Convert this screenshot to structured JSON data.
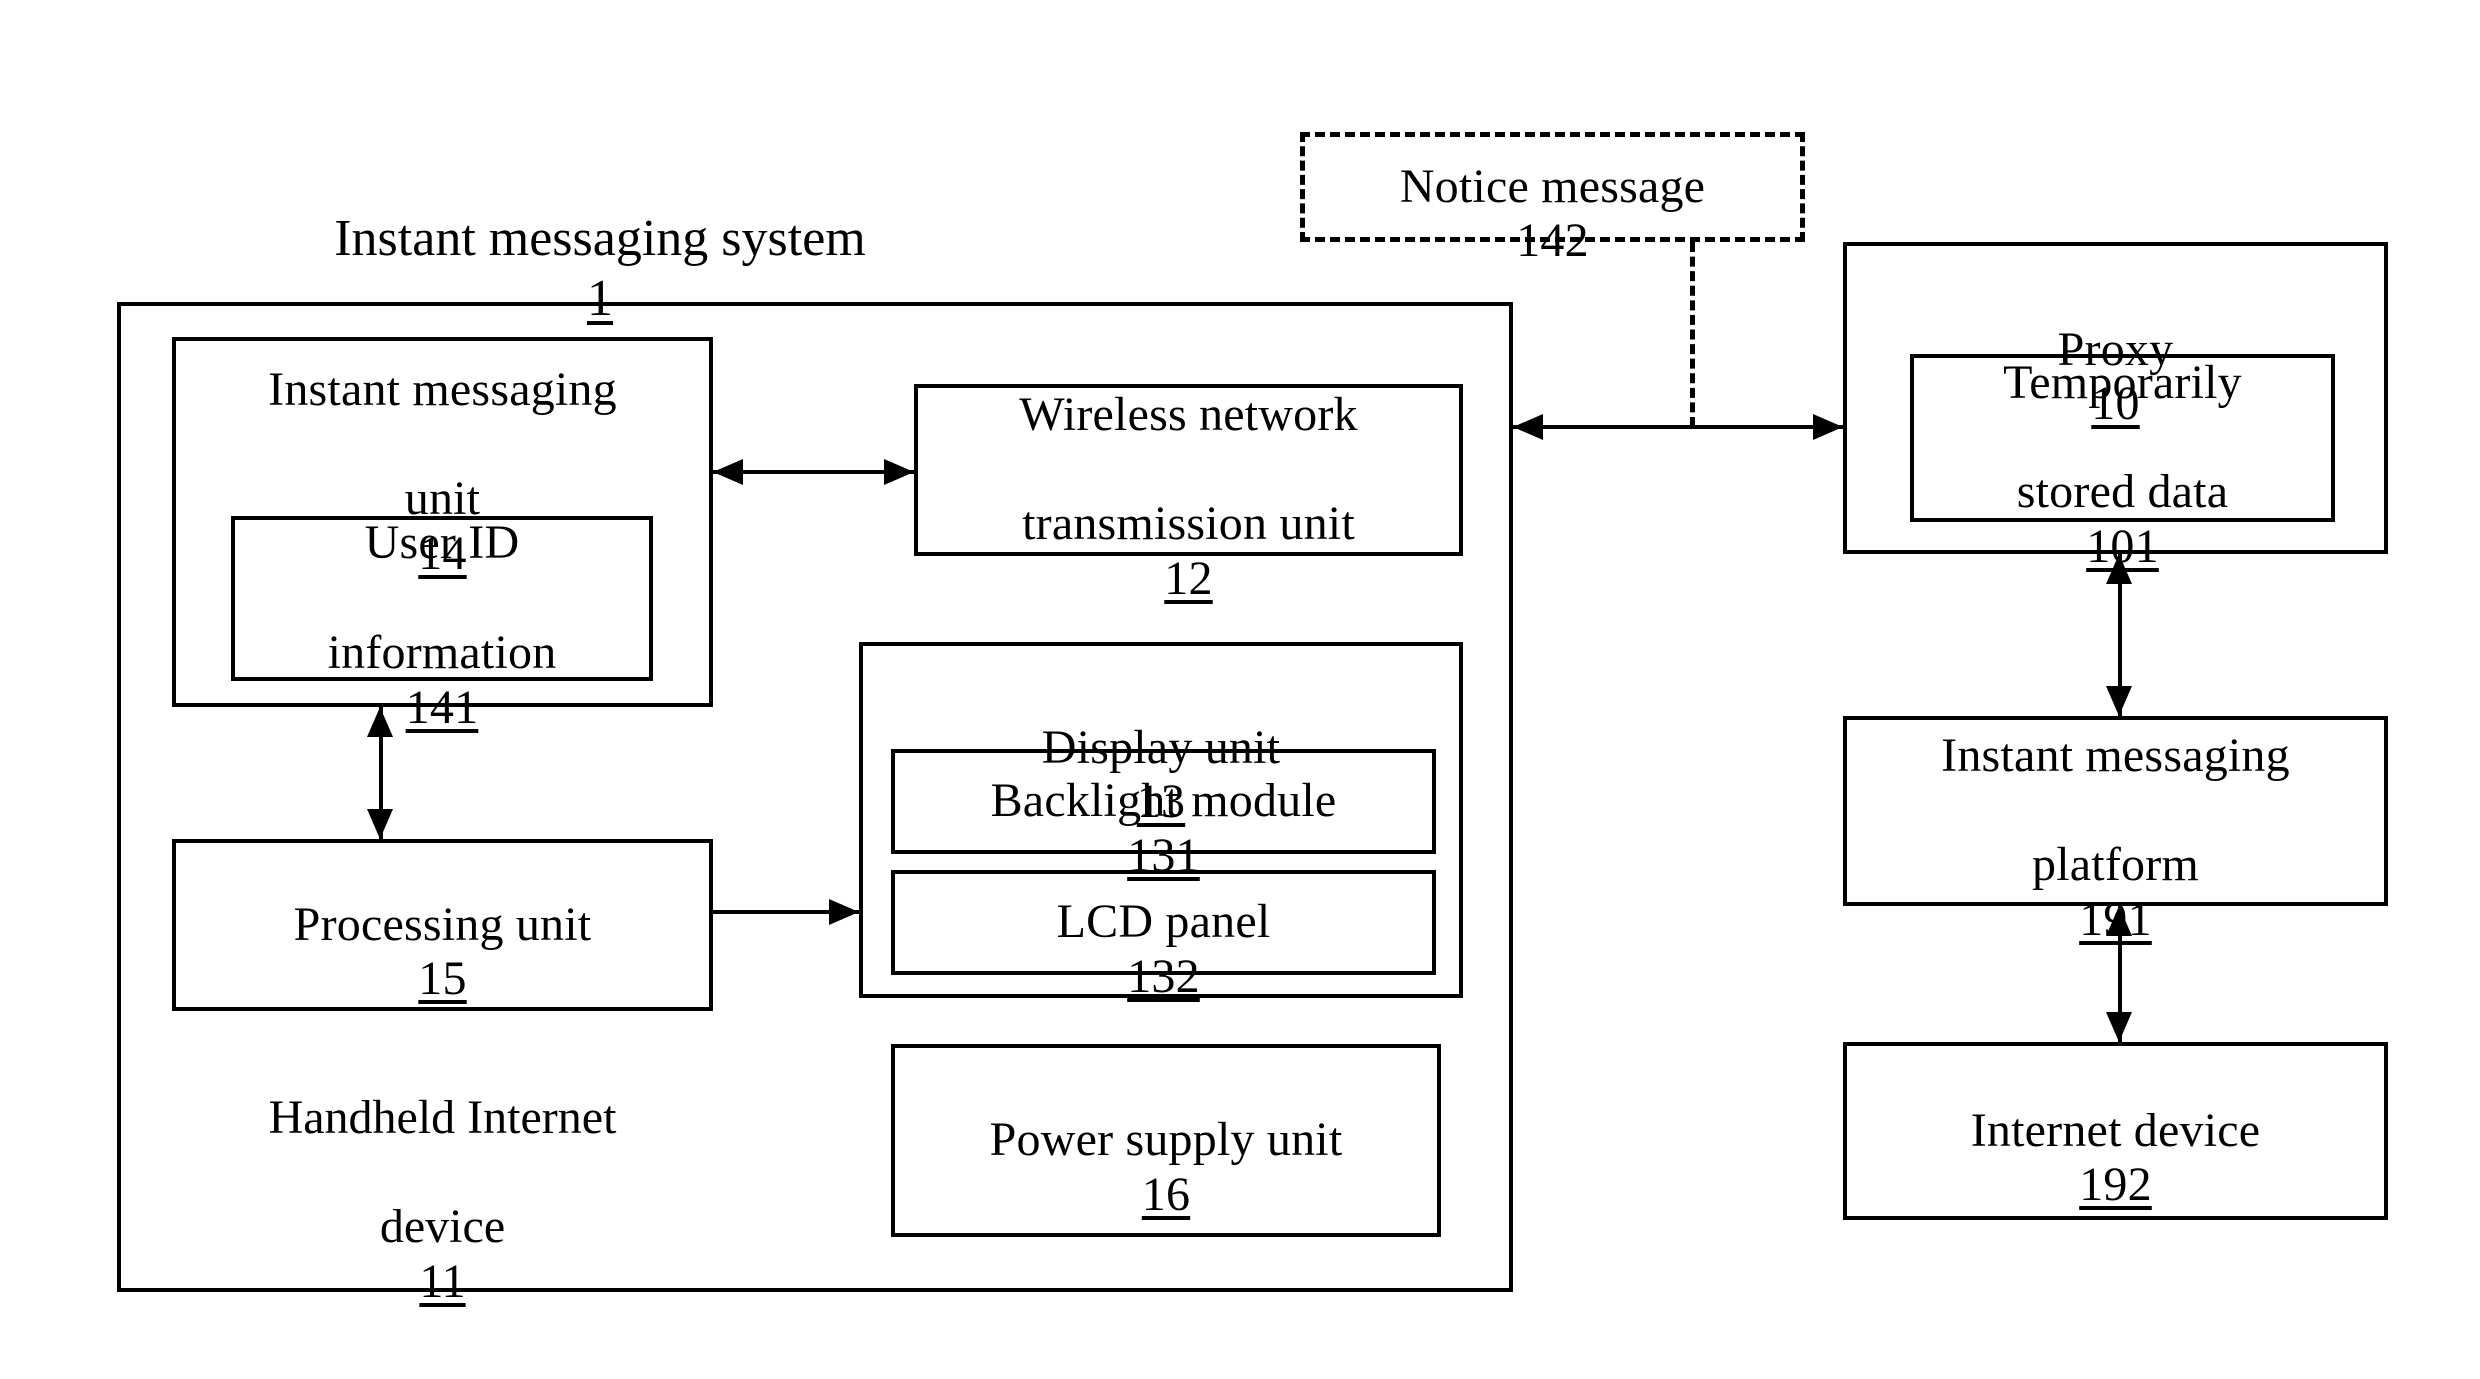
{
  "figure": {
    "title": "Instant messaging system",
    "title_ref": "1",
    "background_color": "#ffffff",
    "line_color": "#000000"
  },
  "system": {
    "handheld_caption": "Handheld Internet",
    "handheld_caption_line2": "device",
    "handheld_ref": "11",
    "im_unit": {
      "label_line1": "Instant messaging",
      "label_line2": "unit",
      "ref": "14",
      "user_id": {
        "label_line1": "User ID",
        "label_line2": "information",
        "ref": "141"
      }
    },
    "wireless_unit": {
      "label_line1": "Wireless network",
      "label_line2": "transmission unit",
      "ref": "12"
    },
    "processing_unit": {
      "label": "Processing unit",
      "ref": "15"
    },
    "display_unit": {
      "label": "Display unit",
      "ref": "13",
      "backlight": {
        "label": "Backlight module",
        "ref": "131"
      },
      "lcd": {
        "label": "LCD panel",
        "ref": "132"
      }
    },
    "power_unit": {
      "label": "Power supply unit",
      "ref": "16"
    }
  },
  "notice": {
    "label": "Notice message",
    "ref": "142"
  },
  "network": {
    "proxy": {
      "label": "Proxy",
      "ref": "10",
      "temp_data": {
        "label_line1": "Temporarily",
        "label_line2": "stored data",
        "ref": "101"
      }
    },
    "im_platform": {
      "label_line1": "Instant messaging",
      "label_line2": "platform",
      "ref": "191"
    },
    "internet_device": {
      "label": "Internet device",
      "ref": "192"
    }
  }
}
